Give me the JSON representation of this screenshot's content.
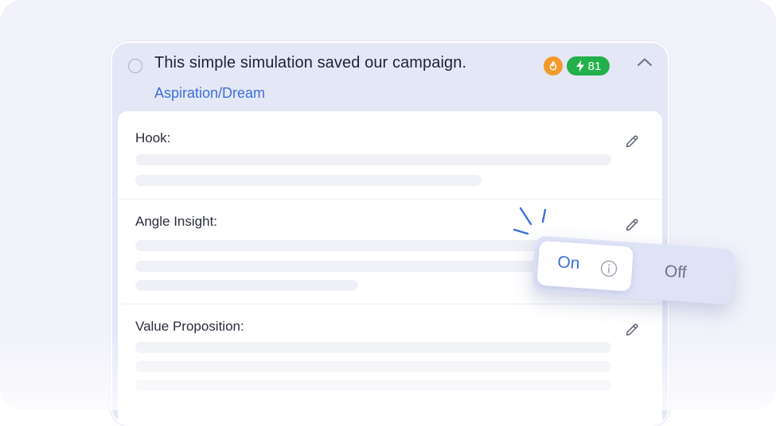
{
  "card": {
    "title": "This simple simulation saved our campaign.",
    "category": "Aspiration/Dream",
    "score": "81"
  },
  "sections": [
    {
      "label": "Hook:"
    },
    {
      "label": "Angle Insight:"
    },
    {
      "label": "Value Proposition:"
    }
  ],
  "toggle": {
    "on_label": "On",
    "off_label": "Off",
    "selected": "On"
  },
  "icons": {
    "radio": "radio-circle-icon",
    "fire": "fire-icon",
    "bolt": "lightning-bolt-icon",
    "collapse": "chevron-up-icon",
    "edit": "pencil-icon",
    "info": "info-icon",
    "spark": "spark-lines-icon"
  },
  "colors": {
    "accent_blue": "#3d6fd8",
    "score_green": "#23b04a",
    "fire_orange": "#f49a2b",
    "card_header": "#e3e7f6"
  }
}
